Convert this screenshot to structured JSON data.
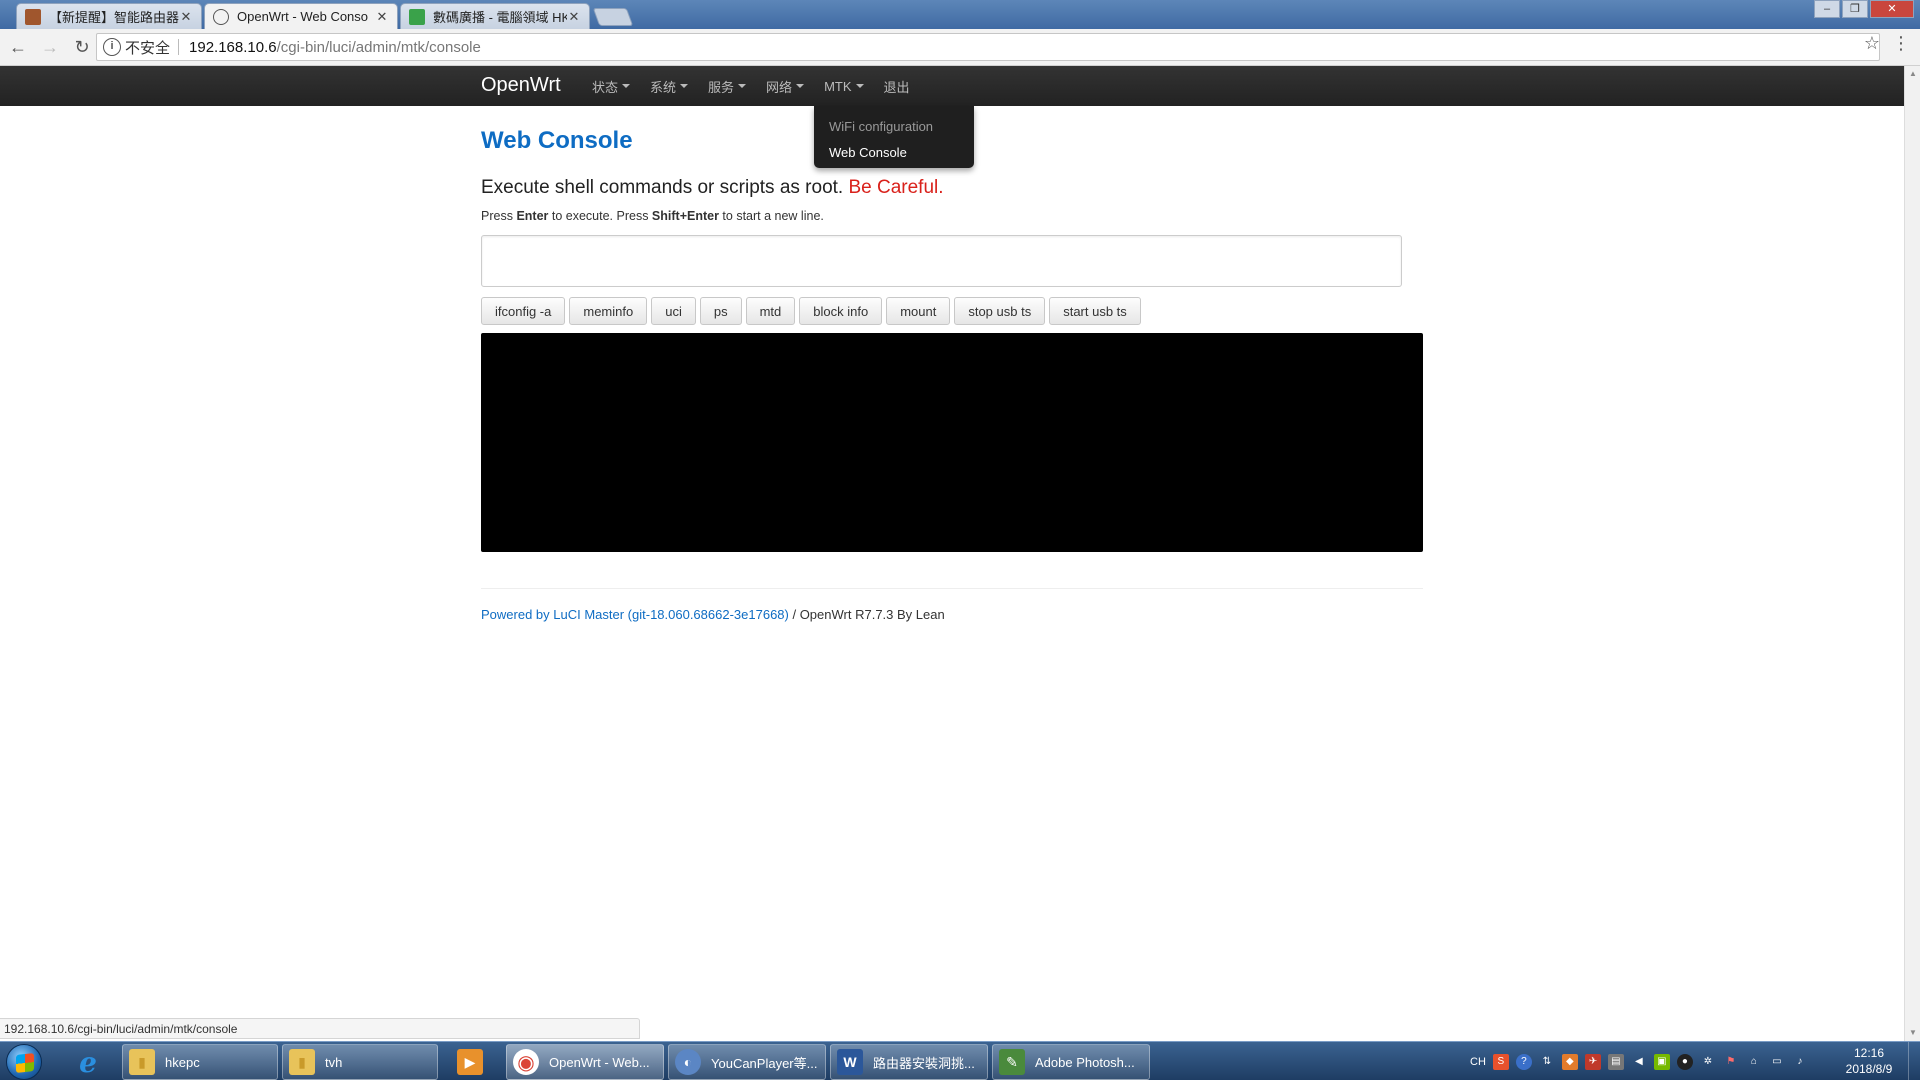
{
  "browser": {
    "tabs": [
      {
        "title": "【新提醒】智能路由器系",
        "favicon": "forum-favicon",
        "color": "#a0562d",
        "active": false
      },
      {
        "title": "OpenWrt - Web Conso",
        "favicon": "globe-favicon",
        "color": "#555555",
        "active": true
      },
      {
        "title": "數碼廣播 - 電腦領域 HK",
        "favicon": "hkepc-favicon",
        "color": "#3aa24a",
        "active": false
      }
    ],
    "tab_close": "✕",
    "back_icon": "←",
    "forward_icon": "→",
    "reload_icon": "↻",
    "info_icon": "i",
    "insecure_label": "不安全",
    "url_host": "192.168.10.6",
    "url_path": "/cgi-bin/luci/admin/mtk/console",
    "star_icon": "☆",
    "menu_icon": "⋮",
    "minimize": "–",
    "maximize": "❐",
    "close": "✕"
  },
  "navbar": {
    "brand": "OpenWrt",
    "items": [
      {
        "label": "状态",
        "dropdown": true
      },
      {
        "label": "系统",
        "dropdown": true
      },
      {
        "label": "服务",
        "dropdown": true
      },
      {
        "label": "网络",
        "dropdown": true
      },
      {
        "label": "MTK",
        "dropdown": true
      },
      {
        "label": "退出",
        "dropdown": false
      }
    ],
    "mtk_menu": [
      {
        "label": "WiFi configuration",
        "current": false
      },
      {
        "label": "Web Console",
        "current": true
      }
    ]
  },
  "content": {
    "title": "Web Console",
    "lead_text": "Execute shell commands or scripts as root. ",
    "lead_warning": "Be Careful.",
    "hint_press": "Press ",
    "hint_enter": "Enter",
    "hint_middle": " to execute. Press ",
    "hint_shift_enter": "Shift+Enter",
    "hint_end": " to start a new line.",
    "input_value": "",
    "buttons": [
      "ifconfig -a",
      "meminfo",
      "uci",
      "ps",
      "mtd",
      "block info",
      "mount",
      "stop usb ts",
      "start usb ts"
    ],
    "footer_link": "Powered by LuCI Master (git-18.060.68662-3e17668)",
    "footer_text": " / OpenWrt R7.7.3 By Lean"
  },
  "statusbar": {
    "url": "192.168.10.6/cgi-bin/luci/admin/mtk/console"
  },
  "taskbar": {
    "pinned": [
      {
        "name": "ie-icon",
        "glyph": "e",
        "color": "#2a8fe0"
      },
      {
        "name": "media-player-icon",
        "glyph": "▶",
        "color": "#e8912c"
      }
    ],
    "windows": [
      {
        "label": "hkepc",
        "icon": "folder-icon",
        "color": "#e8c35a",
        "glyph": "▮"
      },
      {
        "label": "tvh",
        "icon": "folder-icon",
        "color": "#e8c35a",
        "glyph": "▮"
      },
      {
        "label": "OpenWrt - Web...",
        "icon": "chrome-icon",
        "color": "#db4437",
        "glyph": "◉"
      },
      {
        "label": "YouCanPlayer等...",
        "icon": "player-icon",
        "color": "#5b86c4",
        "glyph": "◐"
      },
      {
        "label": "路由器安裝洞挑...",
        "icon": "word-icon",
        "color": "#2b579a",
        "glyph": "W"
      },
      {
        "label": "Adobe Photosh...",
        "icon": "photoshop-icon",
        "color": "#4a8a3c",
        "glyph": "✎"
      }
    ],
    "tray_lang": "CH",
    "clock_time": "12:16",
    "clock_date": "2018/8/9"
  }
}
